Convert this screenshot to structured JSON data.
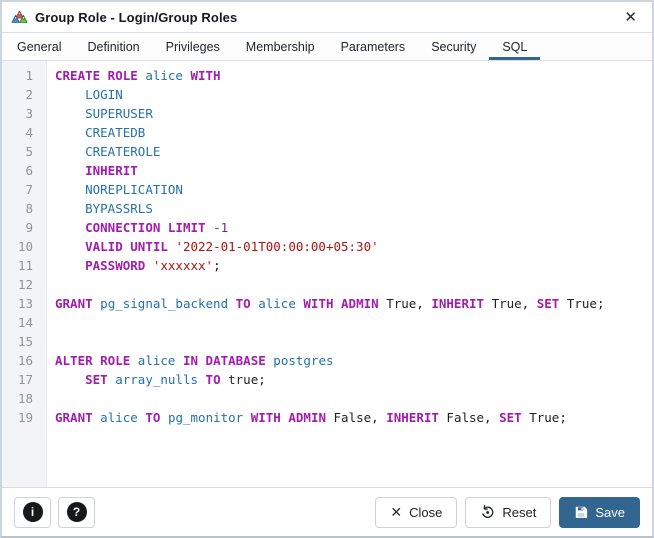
{
  "window": {
    "title": "Group Role - Login/Group Roles",
    "close_icon": "✕"
  },
  "tabs": {
    "items": [
      "General",
      "Definition",
      "Privileges",
      "Membership",
      "Parameters",
      "Security",
      "SQL"
    ],
    "active": "SQL"
  },
  "colors": {
    "accent": "#326690",
    "keyword": "#a21caf",
    "identifier": "#2471ab",
    "string": "#aa1414",
    "number": "#7b1fa2",
    "icon_blue": "#4a90d9",
    "icon_red": "#e05c5c",
    "icon_green": "#6cc24a"
  },
  "editor": {
    "lines": [
      {
        "n": 1,
        "tokens": [
          [
            "kw",
            "CREATE ROLE "
          ],
          [
            "id",
            "alice"
          ],
          [
            "kw",
            " WITH"
          ]
        ]
      },
      {
        "n": 2,
        "tokens": [
          [
            "pl",
            "    "
          ],
          [
            "id",
            "LOGIN"
          ]
        ]
      },
      {
        "n": 3,
        "tokens": [
          [
            "pl",
            "    "
          ],
          [
            "id",
            "SUPERUSER"
          ]
        ]
      },
      {
        "n": 4,
        "tokens": [
          [
            "pl",
            "    "
          ],
          [
            "id",
            "CREATEDB"
          ]
        ]
      },
      {
        "n": 5,
        "tokens": [
          [
            "pl",
            "    "
          ],
          [
            "id",
            "CREATEROLE"
          ]
        ]
      },
      {
        "n": 6,
        "tokens": [
          [
            "pl",
            "    "
          ],
          [
            "kw",
            "INHERIT"
          ]
        ]
      },
      {
        "n": 7,
        "tokens": [
          [
            "pl",
            "    "
          ],
          [
            "id",
            "NOREPLICATION"
          ]
        ]
      },
      {
        "n": 8,
        "tokens": [
          [
            "pl",
            "    "
          ],
          [
            "id",
            "BYPASSRLS"
          ]
        ]
      },
      {
        "n": 9,
        "tokens": [
          [
            "pl",
            "    "
          ],
          [
            "kw",
            "CONNECTION LIMIT"
          ],
          [
            "pl",
            " "
          ],
          [
            "num",
            "-1"
          ]
        ]
      },
      {
        "n": 10,
        "tokens": [
          [
            "pl",
            "    "
          ],
          [
            "kw",
            "VALID UNTIL"
          ],
          [
            "pl",
            " "
          ],
          [
            "str",
            "'2022-01-01T00:00:00+05:30'"
          ]
        ]
      },
      {
        "n": 11,
        "tokens": [
          [
            "pl",
            "    "
          ],
          [
            "kw",
            "PASSWORD"
          ],
          [
            "pl",
            " "
          ],
          [
            "str",
            "'xxxxxx'"
          ],
          [
            "pl",
            ";"
          ]
        ]
      },
      {
        "n": 12,
        "tokens": []
      },
      {
        "n": 13,
        "tokens": [
          [
            "kw",
            "GRANT"
          ],
          [
            "pl",
            " "
          ],
          [
            "id",
            "pg_signal_backend"
          ],
          [
            "pl",
            " "
          ],
          [
            "kw",
            "TO"
          ],
          [
            "pl",
            " "
          ],
          [
            "id",
            "alice"
          ],
          [
            "pl",
            " "
          ],
          [
            "kw",
            "WITH ADMIN"
          ],
          [
            "pl",
            " True, "
          ],
          [
            "kw",
            "INHERIT"
          ],
          [
            "pl",
            " True, "
          ],
          [
            "kw",
            "SET"
          ],
          [
            "pl",
            " True;"
          ]
        ]
      },
      {
        "n": 14,
        "tokens": []
      },
      {
        "n": 15,
        "tokens": []
      },
      {
        "n": 16,
        "tokens": [
          [
            "kw",
            "ALTER ROLE"
          ],
          [
            "pl",
            " "
          ],
          [
            "id",
            "alice"
          ],
          [
            "pl",
            " "
          ],
          [
            "kw",
            "IN DATABASE"
          ],
          [
            "pl",
            " "
          ],
          [
            "id",
            "postgres"
          ]
        ]
      },
      {
        "n": 17,
        "tokens": [
          [
            "pl",
            "    "
          ],
          [
            "kw",
            "SET"
          ],
          [
            "pl",
            " "
          ],
          [
            "id",
            "array_nulls"
          ],
          [
            "pl",
            " "
          ],
          [
            "kw",
            "TO"
          ],
          [
            "pl",
            " true;"
          ]
        ]
      },
      {
        "n": 18,
        "tokens": []
      },
      {
        "n": 19,
        "tokens": [
          [
            "kw",
            "GRANT"
          ],
          [
            "pl",
            " "
          ],
          [
            "id",
            "alice"
          ],
          [
            "pl",
            " "
          ],
          [
            "kw",
            "TO"
          ],
          [
            "pl",
            " "
          ],
          [
            "id",
            "pg_monitor"
          ],
          [
            "pl",
            " "
          ],
          [
            "kw",
            "WITH ADMIN"
          ],
          [
            "pl",
            " False, "
          ],
          [
            "kw",
            "INHERIT"
          ],
          [
            "pl",
            " False, "
          ],
          [
            "kw",
            "SET"
          ],
          [
            "pl",
            " True;"
          ]
        ]
      }
    ]
  },
  "footer": {
    "info_glyph": "i",
    "help_glyph": "?",
    "close_icon": "✕",
    "close_label": "Close",
    "reset_label": "Reset",
    "save_label": "Save"
  }
}
